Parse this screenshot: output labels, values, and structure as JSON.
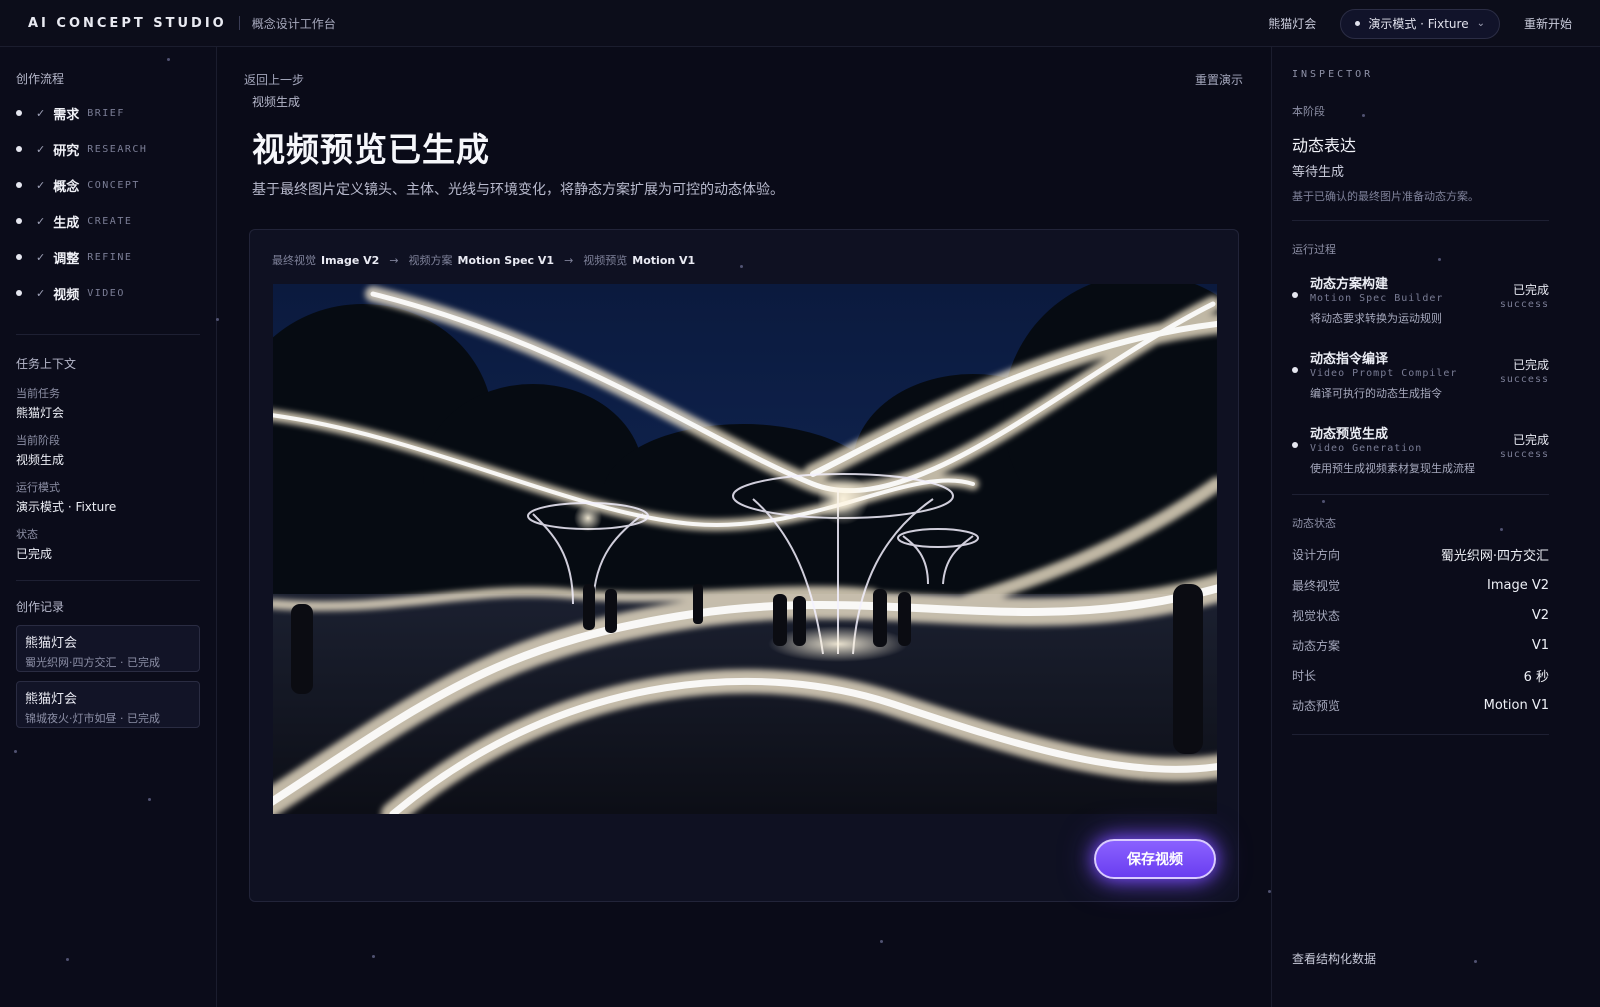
{
  "header": {
    "brand": "AI CONCEPT STUDIO",
    "brand_sub": "概念设计工作台",
    "project": "熊猫灯会",
    "mode": "演示模式 · Fixture",
    "restart": "重新开始"
  },
  "sidebar": {
    "flow_title": "创作流程",
    "steps": [
      {
        "cn": "需求",
        "en": "BRIEF"
      },
      {
        "cn": "研究",
        "en": "RESEARCH"
      },
      {
        "cn": "概念",
        "en": "CONCEPT"
      },
      {
        "cn": "生成",
        "en": "CREATE"
      },
      {
        "cn": "调整",
        "en": "REFINE"
      },
      {
        "cn": "视频",
        "en": "VIDEO"
      }
    ],
    "check": "✓",
    "context_title": "任务上下文",
    "context": [
      {
        "label": "当前任务",
        "value": "熊猫灯会"
      },
      {
        "label": "当前阶段",
        "value": "视频生成"
      },
      {
        "label": "运行模式",
        "value": "演示模式 · Fixture"
      },
      {
        "label": "状态",
        "value": "已完成"
      }
    ],
    "records_title": "创作记录",
    "records": [
      {
        "title": "熊猫灯会",
        "sub": "蜀光织网·四方交汇 · 已完成"
      },
      {
        "title": "熊猫灯会",
        "sub": "锦城夜火·灯市如昼 · 已完成"
      }
    ]
  },
  "main": {
    "back": "返回上一步",
    "reset_demo": "重置演示",
    "crumb": "视频生成",
    "title": "视频预览已生成",
    "subtitle": "基于最终图片定义镜头、主体、光线与环境变化，将静态方案扩展为可控的动态体验。",
    "pipeline": [
      {
        "label": "最终视觉",
        "value": "Image V2"
      },
      {
        "label": "视频方案",
        "value": "Motion Spec V1"
      },
      {
        "label": "视频预览",
        "value": "Motion V1"
      }
    ],
    "arrow": "→",
    "save_label": "保存视频"
  },
  "inspector": {
    "head": "INSPECTOR",
    "stage_label": "本阶段",
    "stage": "动态表达",
    "stage_sub": "等待生成",
    "stage_desc": "基于已确认的最终图片准备动态方案。",
    "process_label": "运行过程",
    "process": [
      {
        "title": "动态方案构建",
        "en": "Motion Spec Builder",
        "desc": "将动态要求转换为运动规则",
        "status": "已完成",
        "code": "success"
      },
      {
        "title": "动态指令编译",
        "en": "Video Prompt Compiler",
        "desc": "编译可执行的动态生成指令",
        "status": "已完成",
        "code": "success"
      },
      {
        "title": "动态预览生成",
        "en": "Video Generation",
        "desc": "使用预生成视频素材复现生成流程",
        "status": "已完成",
        "code": "success"
      }
    ],
    "state_label": "动态状态",
    "state": [
      {
        "k": "设计方向",
        "v": "蜀光织网·四方交汇"
      },
      {
        "k": "最终视觉",
        "v": "Image V2"
      },
      {
        "k": "视觉状态",
        "v": "V2"
      },
      {
        "k": "动态方案",
        "v": "V1"
      },
      {
        "k": "时长",
        "v": "6 秒"
      },
      {
        "k": "动态预览",
        "v": "Motion V1"
      }
    ],
    "structured_link": "查看结构化数据"
  },
  "colors": {
    "accent": "#7b4dff",
    "background": "#0a0b18"
  }
}
